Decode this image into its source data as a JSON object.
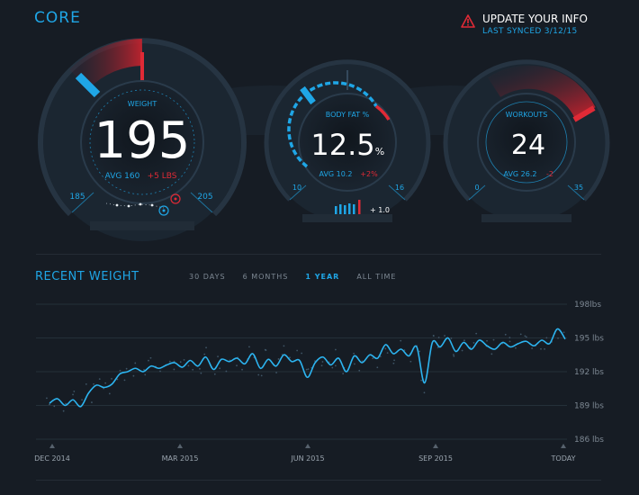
{
  "header": {
    "title": "CORE",
    "alert_title": "UPDATE YOUR INFO",
    "alert_sub": "LAST SYNCED 3/12/15",
    "alert_icon": "warning-triangle-icon"
  },
  "gauges": {
    "weight": {
      "label": "WEIGHT",
      "value": "195",
      "avg": "AVG 160",
      "delta": "+5 LBS",
      "min": "185",
      "max": "205",
      "fill_fraction": 0.5
    },
    "body_fat": {
      "label": "BODY FAT %",
      "value": "12.5",
      "unit": "%",
      "avg": "AVG 10.2",
      "delta": "+2%",
      "min": "10",
      "max": "16",
      "trend": "+ 1.0"
    },
    "workouts": {
      "label": "WORKOUTS",
      "value": "24",
      "avg": "AVG 26.2",
      "delta": "-2",
      "min": "0",
      "max": "35"
    }
  },
  "recent_weight": {
    "title": "RECENT WEIGHT",
    "tabs": [
      {
        "label": "30 DAYS",
        "active": false
      },
      {
        "label": "6 MONTHS",
        "active": false
      },
      {
        "label": "1 YEAR",
        "active": true
      },
      {
        "label": "ALL TIME",
        "active": false
      }
    ]
  },
  "colors": {
    "accent": "#1fa6e6",
    "alert": "#e02a36",
    "background": "#161c24"
  },
  "chart_data": {
    "type": "line",
    "x_tick_labels": [
      "DEC 2014",
      "MAR 2015",
      "JUN 2015",
      "SEP 2015",
      "TODAY"
    ],
    "y_tick_labels": [
      "198lbs",
      "195 lbs",
      "192 lbs",
      "189 lbs",
      "186 lbs"
    ],
    "ylim": [
      186,
      198
    ],
    "grid": true,
    "series": [
      {
        "values": [
          189.2,
          189.6,
          189.0,
          189.5,
          188.9,
          190.1,
          190.8,
          190.6,
          190.9,
          191.8,
          192.0,
          192.3,
          192.0,
          192.5,
          192.3,
          192.6,
          192.8,
          192.4,
          193.0,
          192.5,
          193.3,
          192.2,
          193.1,
          192.9,
          193.2,
          192.7,
          193.6,
          192.3,
          193.1,
          192.5,
          193.5,
          192.9,
          193.0,
          191.5,
          192.8,
          193.3,
          192.6,
          193.2,
          192.0,
          193.4,
          192.8,
          193.5,
          193.2,
          194.4,
          193.6,
          194.0,
          193.4,
          194.2,
          191.0,
          194.6,
          194.2,
          195.0,
          193.8,
          194.6,
          194.0,
          194.8,
          194.3,
          194.0,
          194.6,
          194.2,
          194.5,
          194.7,
          194.3,
          194.8,
          194.5,
          195.8,
          194.9
        ]
      }
    ]
  }
}
